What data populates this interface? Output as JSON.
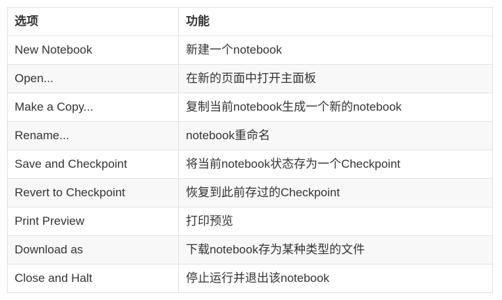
{
  "table": {
    "headers": [
      "选项",
      "功能"
    ],
    "rows": [
      [
        "New Notebook",
        "新建一个notebook"
      ],
      [
        "Open...",
        "在新的页面中打开主面板"
      ],
      [
        "Make a Copy...",
        "复制当前notebook生成一个新的notebook"
      ],
      [
        "Rename...",
        "notebook重命名"
      ],
      [
        "Save and Checkpoint",
        "将当前notebook状态存为一个Checkpoint"
      ],
      [
        "Revert to Checkpoint",
        "恢复到此前存过的Checkpoint"
      ],
      [
        "Print Preview",
        "打印预览"
      ],
      [
        "Download as",
        "下载notebook存为某种类型的文件"
      ],
      [
        "Close and Halt",
        "停止运行并退出该notebook"
      ]
    ]
  }
}
